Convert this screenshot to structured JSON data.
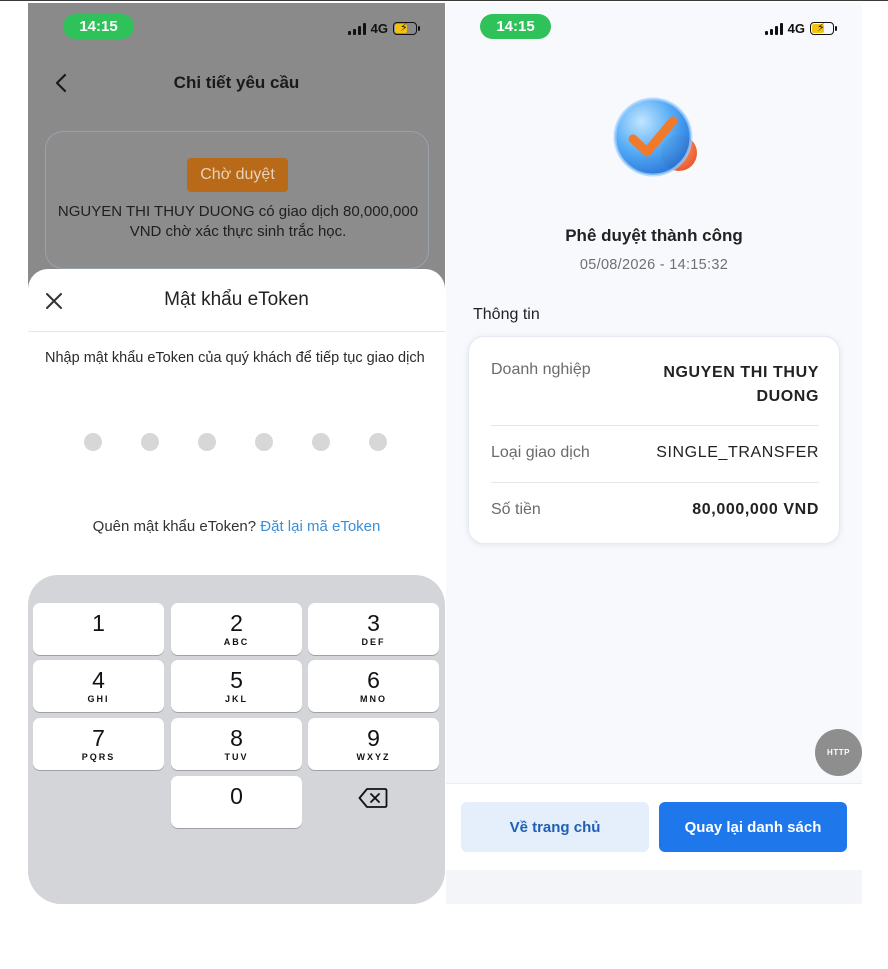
{
  "left": {
    "status": {
      "time": "14:15",
      "network": "4G"
    },
    "header": {
      "title": "Chi tiết yêu cầu"
    },
    "request_card": {
      "status_badge": "Chờ duyệt",
      "description": "NGUYEN THI THUY DUONG có giao dịch 80,000,000 VND chờ xác thực sinh trắc học."
    },
    "sheet": {
      "title": "Mật khẩu eToken",
      "description": "Nhập mật khẩu eToken của quý khách để tiếp tục giao dịch",
      "pin_length": 6,
      "forgot_text": "Quên mật khẩu eToken?",
      "reset_link": "Đặt lại mã eToken"
    },
    "keypad": {
      "keys": [
        {
          "num": "1",
          "letters": ""
        },
        {
          "num": "2",
          "letters": "ABC"
        },
        {
          "num": "3",
          "letters": "DEF"
        },
        {
          "num": "4",
          "letters": "GHI"
        },
        {
          "num": "5",
          "letters": "JKL"
        },
        {
          "num": "6",
          "letters": "MNO"
        },
        {
          "num": "7",
          "letters": "PQRS"
        },
        {
          "num": "8",
          "letters": "TUV"
        },
        {
          "num": "9",
          "letters": "WXYZ"
        },
        {
          "num": "0",
          "letters": ""
        }
      ]
    }
  },
  "right": {
    "status": {
      "time": "14:15",
      "network": "4G"
    },
    "success": {
      "title": "Phê duyệt thành công",
      "timestamp": "05/08/2026 - 14:15:32"
    },
    "info": {
      "heading": "Thông tin",
      "rows": [
        {
          "label": "Doanh nghiệp",
          "value_line1": "NGUYEN THI THUY",
          "value_line2": "DUONG"
        },
        {
          "label": "Loại giao dịch",
          "value": "SINGLE_TRANSFER"
        },
        {
          "label": "Số tiền",
          "value": "80,000,000 VND"
        }
      ]
    },
    "fab": {
      "label": "HTTP"
    },
    "buttons": {
      "home": "Về trang chủ",
      "back_to_list": "Quay lại danh sách"
    }
  },
  "colors": {
    "status_green": "#2fc15a",
    "pending_orange": "#b86a18",
    "link_blue": "#3a8ed8",
    "primary_blue": "#1e78ec",
    "secondary_bg": "#e5eefb"
  }
}
